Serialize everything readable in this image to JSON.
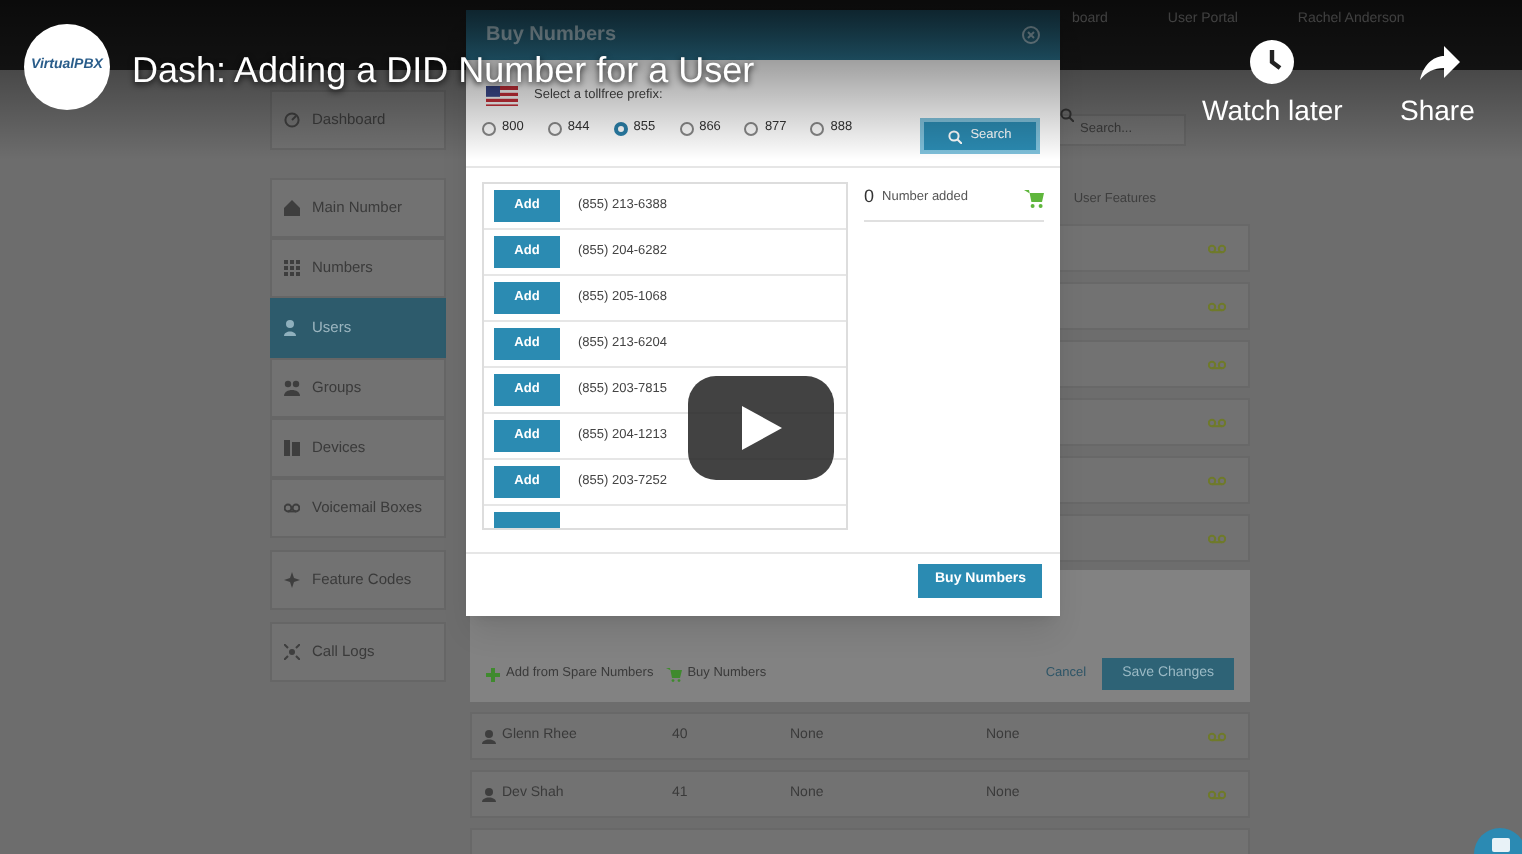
{
  "player": {
    "channel_logo": "VirtualPBX",
    "title": "Dash: Adding a DID Number for a User",
    "actions": [
      {
        "kind": "watch_later",
        "label": "Watch later"
      },
      {
        "kind": "share",
        "label": "Share"
      }
    ]
  },
  "app": {
    "header": [
      "board",
      "User Portal",
      "Rachel Anderson"
    ],
    "search": {
      "placeholder": "Search..."
    },
    "sidebar": {
      "items": [
        {
          "label": "Dashboard",
          "selected": false
        },
        {
          "label": "Main Number",
          "selected": false
        },
        {
          "label": "Numbers",
          "selected": false
        },
        {
          "label": "Users",
          "selected": true
        },
        {
          "label": "Groups",
          "selected": false
        },
        {
          "label": "Devices",
          "selected": false
        },
        {
          "label": "Voicemail Boxes",
          "selected": false
        },
        {
          "label": "Feature Codes",
          "selected": false
        },
        {
          "label": "Call Logs",
          "selected": false
        }
      ]
    },
    "table": {
      "column_header": "User Features"
    },
    "panel": {
      "actions": [
        {
          "kind": "add",
          "label": "Add from Spare Numbers"
        },
        {
          "kind": "buy",
          "label": "Buy Numbers"
        }
      ],
      "cancel": "Cancel",
      "save": "Save Changes"
    },
    "users": [
      {
        "name": "Glenn Rhee",
        "extension": "40",
        "column_3": "None",
        "column_4": "None"
      },
      {
        "name": "Dev Shah",
        "extension": "41",
        "column_3": "None",
        "column_4": "None"
      }
    ]
  },
  "dialog": {
    "title": "Buy Numbers",
    "prefix_label": "Select a tollfree prefix:",
    "prefixes": [
      {
        "label": "800",
        "selected": false
      },
      {
        "label": "844",
        "selected": false
      },
      {
        "label": "855",
        "selected": true
      },
      {
        "label": "866",
        "selected": false
      },
      {
        "label": "877",
        "selected": false
      },
      {
        "label": "888",
        "selected": false
      }
    ],
    "search_button": "Search",
    "numbers": [
      {
        "button": "Add",
        "number": "(855) 213-6388"
      },
      {
        "button": "Add",
        "number": "(855) 204-6282"
      },
      {
        "button": "Add",
        "number": "(855) 205-1068"
      },
      {
        "button": "Add",
        "number": "(855) 213-6204"
      },
      {
        "button": "Add",
        "number": "(855) 203-7815"
      },
      {
        "button": "Add",
        "number": "(855) 204-1213"
      },
      {
        "button": "Add",
        "number": "(855) 203-7252"
      }
    ],
    "count": "0",
    "count_label": "Number added",
    "buy_button": "Buy Numbers"
  }
}
